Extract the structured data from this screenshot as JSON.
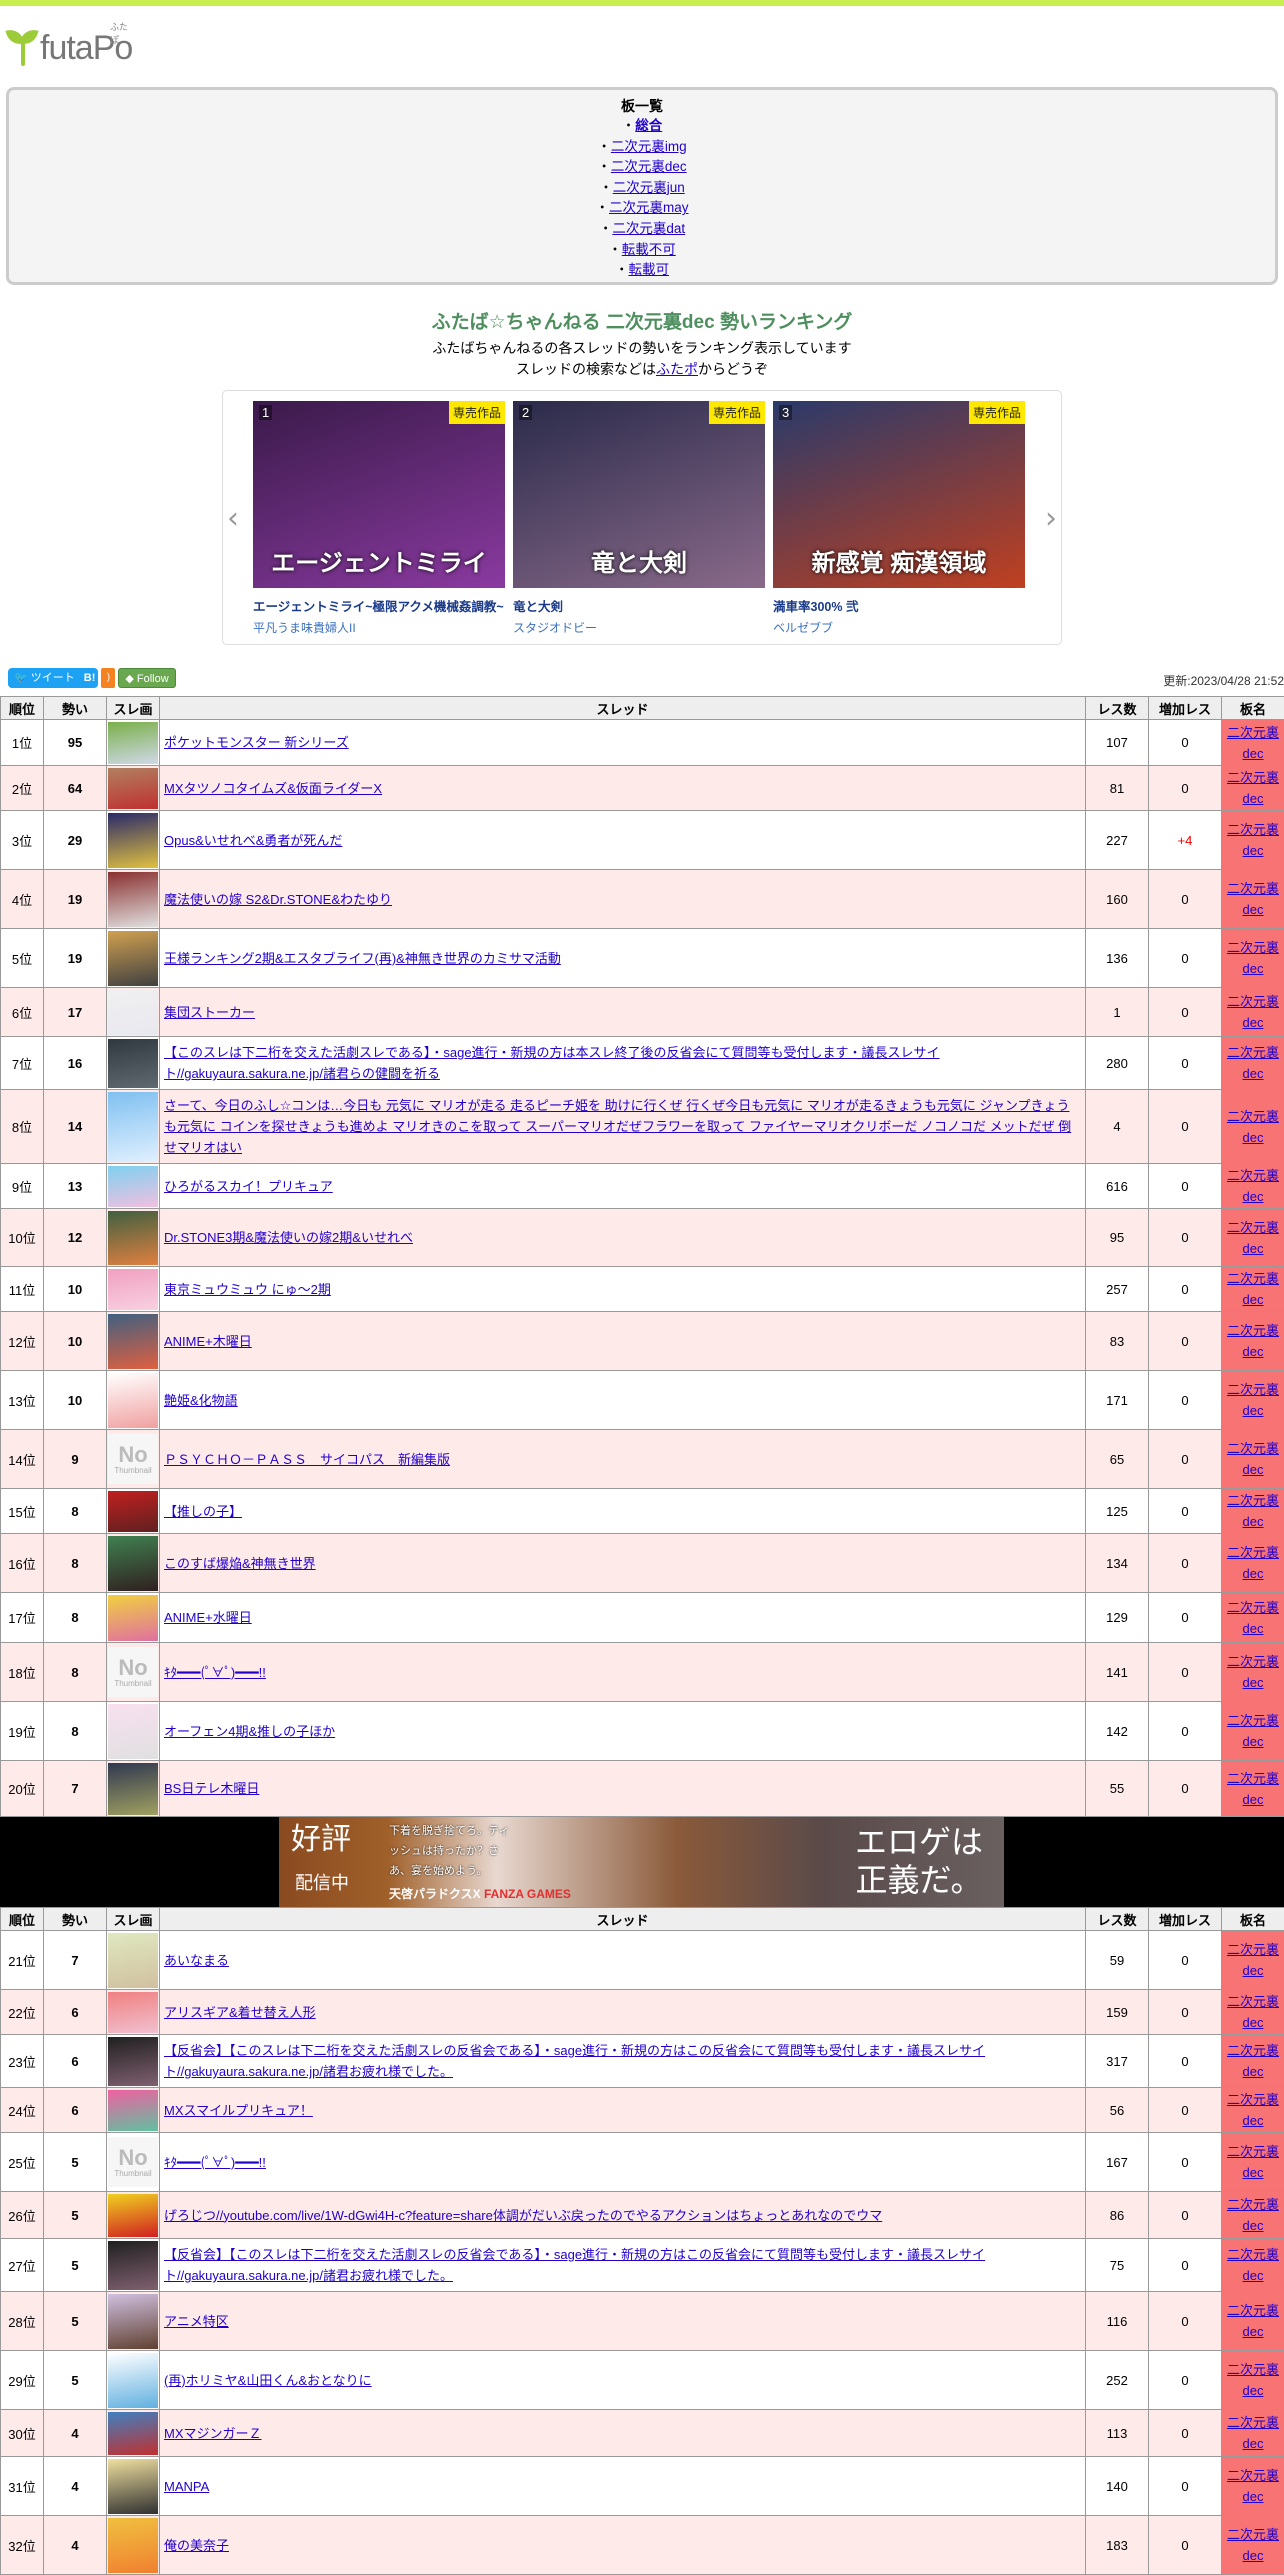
{
  "logo": {
    "text": "futaPo",
    "ruby": "ふたぽ"
  },
  "boards": {
    "heading": "板一覧",
    "items": [
      {
        "label": "総合",
        "active": true
      },
      {
        "label": "二次元裏img"
      },
      {
        "label": "二次元裏dec"
      },
      {
        "label": "二次元裏jun"
      },
      {
        "label": "二次元裏may"
      },
      {
        "label": "二次元裏dat"
      },
      {
        "label": "転載不可"
      },
      {
        "label": "転載可"
      }
    ]
  },
  "intro": {
    "title": "ふたば☆ちゃんねる 二次元裏dec 勢いランキング",
    "line1": "ふたばちゃんねるの各スレッドの勢いをランキング表示しています",
    "line2_pre": "スレッドの検索などは",
    "line2_link": "ふたポ",
    "line2_post": "からどうぞ"
  },
  "carousel": {
    "badge": "専売作品",
    "items": [
      {
        "num": "1",
        "title": "エージェントミライ~極限アクメ機械姦調教~",
        "circle": "平凡うま味貴婦人II",
        "caption": "エージェントミライ",
        "colors": [
          "#3a1a4a",
          "#8a3aa0"
        ]
      },
      {
        "num": "2",
        "title": "竜と大剣",
        "circle": "スタジオドビー",
        "caption": "竜と大剣",
        "colors": [
          "#2a2a4a",
          "#8a6a8a"
        ]
      },
      {
        "num": "3",
        "title": "満車率300% 弐",
        "circle": "ベルゼブブ",
        "caption": "新感覚 痴漢領域",
        "colors": [
          "#2a3a6a",
          "#c04020"
        ]
      }
    ]
  },
  "share": {
    "tweet": "ツイート",
    "hatena": "B!",
    "follow": "Follow"
  },
  "updated": "更新:2023/04/28 21:52",
  "table": {
    "headers": [
      "順位",
      "勢い",
      "スレ画",
      "スレッド",
      "レス数",
      "増加レス",
      "板名"
    ],
    "board_line1": "二次元裏",
    "board_line2": "dec"
  },
  "no_thumb": {
    "big": "No",
    "small": "Thumbnail"
  },
  "rows": [
    {
      "rank": "1位",
      "ikioi": "95",
      "title": "ポケットモンスター 新シリーズ",
      "res": "107",
      "inc": "0",
      "c": [
        "#7ab04a",
        "#d0d8e8"
      ]
    },
    {
      "rank": "2位",
      "ikioi": "64",
      "title": "MXタツノコタイムズ&仮面ライダーX",
      "res": "81",
      "inc": "0",
      "c": [
        "#b08060",
        "#c03030"
      ]
    },
    {
      "rank": "3位",
      "ikioi": "29",
      "title": "Opus&いせれべ&勇者が死んだ",
      "res": "227",
      "inc": "+4",
      "c": [
        "#2a2a6a",
        "#e0c040"
      ]
    },
    {
      "rank": "4位",
      "ikioi": "19",
      "title": "魔法使いの嫁 S2&Dr.STONE&わたゆり",
      "res": "160",
      "inc": "0",
      "c": [
        "#8a3030",
        "#e0e0e0"
      ]
    },
    {
      "rank": "5位",
      "ikioi": "19",
      "title": "王様ランキング2期&エスタブライフ(再)&神無き世界のカミサマ活動",
      "res": "136",
      "inc": "0",
      "c": [
        "#d0a050",
        "#404040"
      ]
    },
    {
      "rank": "6位",
      "ikioi": "17",
      "title": "集団ストーカー",
      "res": "1",
      "inc": "0",
      "c": [
        "#f0f0f0",
        "#e8e8f0"
      ]
    },
    {
      "rank": "7位",
      "ikioi": "16",
      "title": "【このスレは下二桁を交えた活劇スレである】・sage進行・新規の方は本スレ終了後の反省会にて質問等も受付します・議長スレサイト//gakuyaura.sakura.ne.jp/諸君らの健闘を祈る",
      "res": "280",
      "inc": "0",
      "c": [
        "#303840",
        "#606870"
      ]
    },
    {
      "rank": "8位",
      "ikioi": "14",
      "title": "さーて、今日のふし☆コンは…今日も 元気に マリオが走る 走るピーチ姫を 助けに行くぜ 行くぜ今日も元気に マリオが走るきょうも元気に ジャンプきょうも元気に コインを探せきょうも進めよ マリオきのこを取って スーパーマリオだぜフラワーを取って ファイヤーマリオクリボーだ ノコノコだ メットだぜ 倒せマリオはい",
      "res": "4",
      "inc": "0",
      "c": [
        "#80c0f0",
        "#e0f0ff"
      ]
    },
    {
      "rank": "9位",
      "ikioi": "13",
      "title": "ひろがるスカイ！プリキュア",
      "res": "616",
      "inc": "0",
      "c": [
        "#80d0f0",
        "#f0c0e0"
      ]
    },
    {
      "rank": "10位",
      "ikioi": "12",
      "title": "Dr.STONE3期&魔法使いの嫁2期&いせれべ",
      "res": "95",
      "inc": "0",
      "c": [
        "#406040",
        "#e08040"
      ]
    },
    {
      "rank": "11位",
      "ikioi": "10",
      "title": "東京ミュウミュウ にゅ～2期",
      "res": "257",
      "inc": "0",
      "c": [
        "#f0a0c0",
        "#f8d0e0"
      ]
    },
    {
      "rank": "12位",
      "ikioi": "10",
      "title": "ANIME+木曜日",
      "res": "83",
      "inc": "0",
      "c": [
        "#406080",
        "#e06040"
      ]
    },
    {
      "rank": "13位",
      "ikioi": "10",
      "title": "艶姫&化物語",
      "res": "171",
      "inc": "0",
      "c": [
        "#ffffff",
        "#f0a0a0"
      ]
    },
    {
      "rank": "14位",
      "ikioi": "9",
      "title": "ＰＳＹＣＨＯ－ＰＡＳＳ　サイコパス　新編集版",
      "res": "65",
      "inc": "0",
      "none": true
    },
    {
      "rank": "15位",
      "ikioi": "8",
      "title": "【推しの子】",
      "res": "125",
      "inc": "0",
      "c": [
        "#c02020",
        "#602020"
      ]
    },
    {
      "rank": "16位",
      "ikioi": "8",
      "title": "このすば爆焔&神無き世界",
      "res": "134",
      "inc": "0",
      "c": [
        "#408050",
        "#302020"
      ]
    },
    {
      "rank": "17位",
      "ikioi": "8",
      "title": "ANIME+水曜日",
      "res": "129",
      "inc": "0",
      "c": [
        "#f0d040",
        "#e070a0"
      ]
    },
    {
      "rank": "18位",
      "ikioi": "8",
      "title": "ｷﾀ━━━(ﾟ∀ﾟ)━━━!!",
      "res": "141",
      "inc": "0",
      "none": true
    },
    {
      "rank": "19位",
      "ikioi": "8",
      "title": "オーフェン4期&推しの子ほか",
      "res": "142",
      "inc": "0",
      "c": [
        "#f8e0f0",
        "#e0e0e0"
      ]
    },
    {
      "rank": "20位",
      "ikioi": "7",
      "title": "BS日テレ木曜日",
      "res": "55",
      "inc": "0",
      "c": [
        "#303850",
        "#a0a060"
      ]
    },
    {
      "rank": "21位",
      "ikioi": "7",
      "title": "あいなまる",
      "res": "59",
      "inc": "0",
      "c": [
        "#e0e8c0",
        "#d0c0a0"
      ]
    },
    {
      "rank": "22位",
      "ikioi": "6",
      "title": "アリスギア&着せ替え人形",
      "res": "159",
      "inc": "0",
      "c": [
        "#f08080",
        "#f0c0d0"
      ]
    },
    {
      "rank": "23位",
      "ikioi": "6",
      "title": "【反省会】【このスレは下二桁を交えた活劇スレの反省会である】・sage進行・新規の方はこの反省会にて質問等も受付します・議長スレサイト//gakuyaura.sakura.ne.jp/諸君お疲れ様でした。",
      "res": "317",
      "inc": "0",
      "c": [
        "#202020",
        "#806070"
      ]
    },
    {
      "rank": "24位",
      "ikioi": "6",
      "title": "MXスマイルプリキュア！",
      "res": "56",
      "inc": "0",
      "c": [
        "#f060a0",
        "#60c0a0"
      ]
    },
    {
      "rank": "25位",
      "ikioi": "5",
      "title": "ｷﾀ━━━(ﾟ∀ﾟ)━━━!!",
      "res": "167",
      "inc": "0",
      "none": true
    },
    {
      "rank": "26位",
      "ikioi": "5",
      "title": "げろじつ//youtube.com/live/1W-dGwi4H-c?feature=share体調がだいぶ戻ったのでやるアクションはちょっとあれなのでウマ",
      "res": "86",
      "inc": "0",
      "c": [
        "#f0d020",
        "#d02020"
      ]
    },
    {
      "rank": "27位",
      "ikioi": "5",
      "title": "【反省会】【このスレは下二桁を交えた活劇スレの反省会である】・sage進行・新規の方はこの反省会にて質問等も受付します・議長スレサイト//gakuyaura.sakura.ne.jp/諸君お疲れ様でした。",
      "res": "75",
      "inc": "0",
      "c": [
        "#202020",
        "#806070"
      ]
    },
    {
      "rank": "28位",
      "ikioi": "5",
      "title": "アニメ特区",
      "res": "116",
      "inc": "0",
      "c": [
        "#d0c0e0",
        "#604030"
      ]
    },
    {
      "rank": "29位",
      "ikioi": "5",
      "title": "(再)ホリミヤ&山田くん&おとなりに",
      "res": "252",
      "inc": "0",
      "c": [
        "#ffffff",
        "#60b0e0"
      ]
    },
    {
      "rank": "30位",
      "ikioi": "4",
      "title": "MXマジンガーＺ",
      "res": "113",
      "inc": "0",
      "c": [
        "#4080c0",
        "#c03030"
      ]
    },
    {
      "rank": "31位",
      "ikioi": "4",
      "title": "MANPA",
      "res": "140",
      "inc": "0",
      "c": [
        "#f0e0a0",
        "#303030"
      ]
    },
    {
      "rank": "32位",
      "ikioi": "4",
      "title": "俺の美奈子",
      "res": "183",
      "inc": "0",
      "c": [
        "#f0c040",
        "#f08030"
      ]
    }
  ],
  "ad": {
    "l1": "好評",
    "l2": "配信中",
    "copy": "下着を脱ぎ捨てろ。ティッシュは持ったか？さあ、宴を始めよう。",
    "brand": "天啓パラドクスX",
    "brand2": "FANZA GAMES",
    "slogan": "エロゲは正義だ。"
  }
}
